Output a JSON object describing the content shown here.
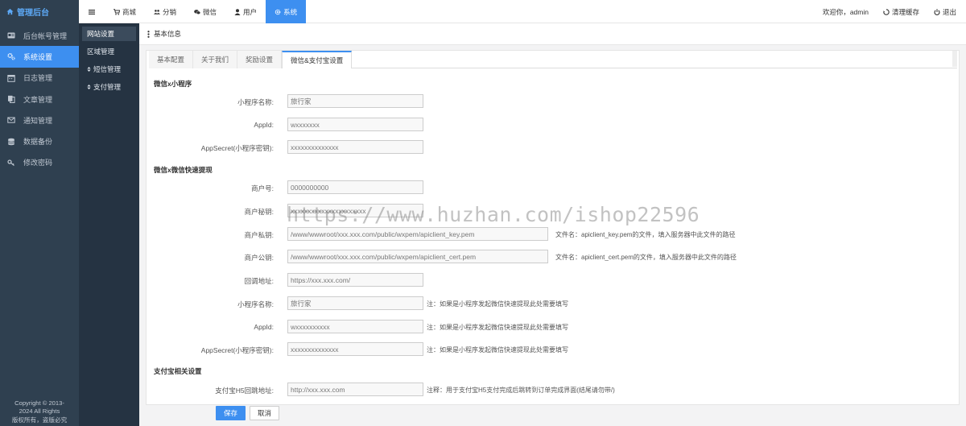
{
  "brand": {
    "title": "管理后台",
    "icon": "home-icon"
  },
  "topnav": [
    {
      "label": "",
      "icon": "menu-icon",
      "name": "topnav-menu-toggle"
    },
    {
      "label": "商城",
      "icon": "cart-icon",
      "name": "topnav-mall"
    },
    {
      "label": "分销",
      "icon": "users-icon",
      "name": "topnav-distribution"
    },
    {
      "label": "微信",
      "icon": "wechat-icon",
      "name": "topnav-wechat"
    },
    {
      "label": "用户",
      "icon": "user-icon",
      "name": "topnav-user"
    },
    {
      "label": "系统",
      "icon": "gear-icon",
      "name": "topnav-system",
      "active": true
    }
  ],
  "topright": {
    "welcome": "欢迎你，admin",
    "clear_cache": "清理缓存",
    "logout": "退出"
  },
  "sidebar": [
    {
      "label": "后台帐号管理",
      "icon": "id-card-icon"
    },
    {
      "label": "系统设置",
      "icon": "cogs-icon",
      "active": true
    },
    {
      "label": "日志管理",
      "icon": "calendar-icon"
    },
    {
      "label": "文章管理",
      "icon": "copy-icon"
    },
    {
      "label": "通知管理",
      "icon": "envelope-icon"
    },
    {
      "label": "数据备份",
      "icon": "database-icon"
    },
    {
      "label": "修改密码",
      "icon": "key-icon"
    }
  ],
  "copyright": {
    "line1": "Copyright © 2013-",
    "line2": "2024 All Rights",
    "line3": "版权所有，盗版必究"
  },
  "subbar": [
    {
      "label": "网站设置",
      "active": true,
      "caret": false
    },
    {
      "label": "区域管理",
      "caret": false
    },
    {
      "label": "短信管理",
      "caret": true
    },
    {
      "label": "支付管理",
      "caret": true
    }
  ],
  "breadcrumb": {
    "title": "基本信息",
    "icon": "vertical-ellipsis-icon"
  },
  "tabs": [
    {
      "label": "基本配置"
    },
    {
      "label": "关于我们"
    },
    {
      "label": "奖励设置"
    },
    {
      "label": "微信&支付宝设置",
      "active": true
    }
  ],
  "sections": {
    "miniprogram": "微信x小程序",
    "withdraw": "微信x微信快速提现",
    "alipay": "支付宝相关设置"
  },
  "fields": {
    "mp_name": {
      "label": "小程序名称:",
      "value": "旅行家"
    },
    "mp_appid": {
      "label": "AppId:",
      "value": "wxxxxxxx"
    },
    "mp_secret": {
      "label": "AppSecret(小程序密钥):",
      "value": "xxxxxxxxxxxxxx"
    },
    "mch_id": {
      "label": "商户号:",
      "value": "0000000000"
    },
    "mch_key": {
      "label": "商户秘钥:",
      "value": "xxxxxxxxxxxxxxxxxxxxxx"
    },
    "mch_private": {
      "label": "商户私钥:",
      "value": "/www/wwwroot/xxx.xxx.com/public/wxpem/apiclient_key.pem",
      "note": "文件名：apiclient_key.pem的文件，填入服务器中此文件的路径"
    },
    "mch_public": {
      "label": "商户公钥:",
      "value": "/www/wwwroot/xxx.xxx.com/public/wxpem/apiclient_cert.pem",
      "note": "文件名：apiclient_cert.pem的文件，填入服务器中此文件的路径"
    },
    "callback": {
      "label": "回调地址:",
      "value": "https://xxx.xxx.com/"
    },
    "w_mp_name": {
      "label": "小程序名称:",
      "value": "旅行家",
      "note": "注：如果是小程序发起微信快速提现此处需要填写"
    },
    "w_appid": {
      "label": "AppId:",
      "value": "wxxxxxxxxxx",
      "note": "注：如果是小程序发起微信快速提现此处需要填写"
    },
    "w_secret": {
      "label": "AppSecret(小程序密钥):",
      "value": "xxxxxxxxxxxxxx",
      "note": "注：如果是小程序发起微信快速提现此处需要填写"
    },
    "alipay_h5": {
      "label": "支付宝H5回跳地址:",
      "value": "http://xxx.xxx.com",
      "note": "注释：用于支付宝H5支付完成后跳转到订单完成界面(结尾请勿带/)"
    }
  },
  "watermark": "https://www.huzhan.com/ishop22596",
  "buttons": {
    "save": "保存",
    "cancel": "取消"
  },
  "colors": {
    "accent": "#3d8ff0",
    "sidebar": "#2f4050",
    "subbar": "#253342"
  }
}
